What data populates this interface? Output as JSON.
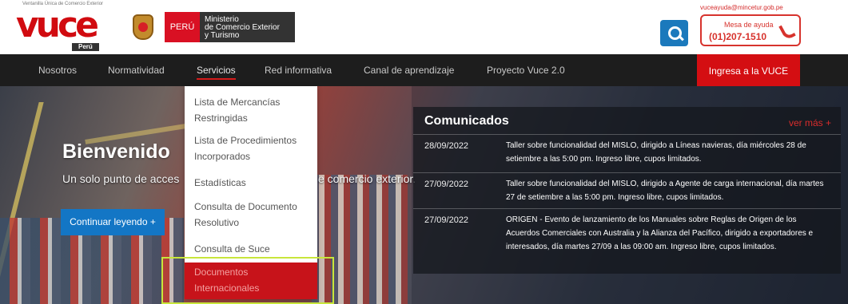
{
  "header": {
    "tiny_top_text": "Ventanilla Única de Comercio Exterior",
    "logo_text": "vuce",
    "logo_sub": "Perú",
    "gov_peru": "PERÚ",
    "gov_line1": "Ministerio",
    "gov_line2": "de Comercio Exterior",
    "gov_line3": "y Turismo",
    "email": "vuceayuda@mincetur.gob.pe",
    "help_label": "Mesa de ayuda",
    "help_phone": "(01)207-1510",
    "search_icon": "search-icon",
    "phone_icon": "phone-icon",
    "accent_color": "#d40e12"
  },
  "nav": {
    "items": [
      "Nosotros",
      "Normatividad",
      "Servicios",
      "Red informativa",
      "Canal de aprendizaje",
      "Proyecto Vuce 2.0"
    ],
    "active_item": "Servicios",
    "cta": "Ingresa a la VUCE"
  },
  "hero": {
    "title": "Bienvenido",
    "subtitle_left": "Un solo punto de acces",
    "subtitle_right": "e comercio exterior.",
    "button": "Continuar leyendo +"
  },
  "dropdown": {
    "items": [
      "Lista de Mercancías Restringidas",
      "Lista de Procedimientos Incorporados",
      "Estadísticas",
      "Consulta de Documento Resolutivo",
      "Consulta de Suce",
      "Documentos Internacionales"
    ]
  },
  "communications": {
    "title": "Comunicados",
    "more": "ver más +",
    "items": [
      {
        "date": "28/09/2022",
        "text": "Taller sobre funcionalidad del MISLO, dirigido a Líneas navieras, día miércoles 28 de setiembre a las 5:00 pm. Ingreso libre, cupos limitados."
      },
      {
        "date": "27/09/2022",
        "text": "Taller sobre funcionalidad del MISLO, dirigido a Agente de carga internacional, día martes 27 de setiembre a las 5:00 pm. Ingreso libre, cupos limitados."
      },
      {
        "date": "27/09/2022",
        "text": "ORIGEN - Evento de lanzamiento de los Manuales sobre Reglas de Origen de los Acuerdos Comerciales con Australia y la Alianza del Pacífico, dirigido a exportadores e interesados, día martes 27/09 a las 09:00 am. Ingreso libre, cupos limitados."
      }
    ]
  }
}
